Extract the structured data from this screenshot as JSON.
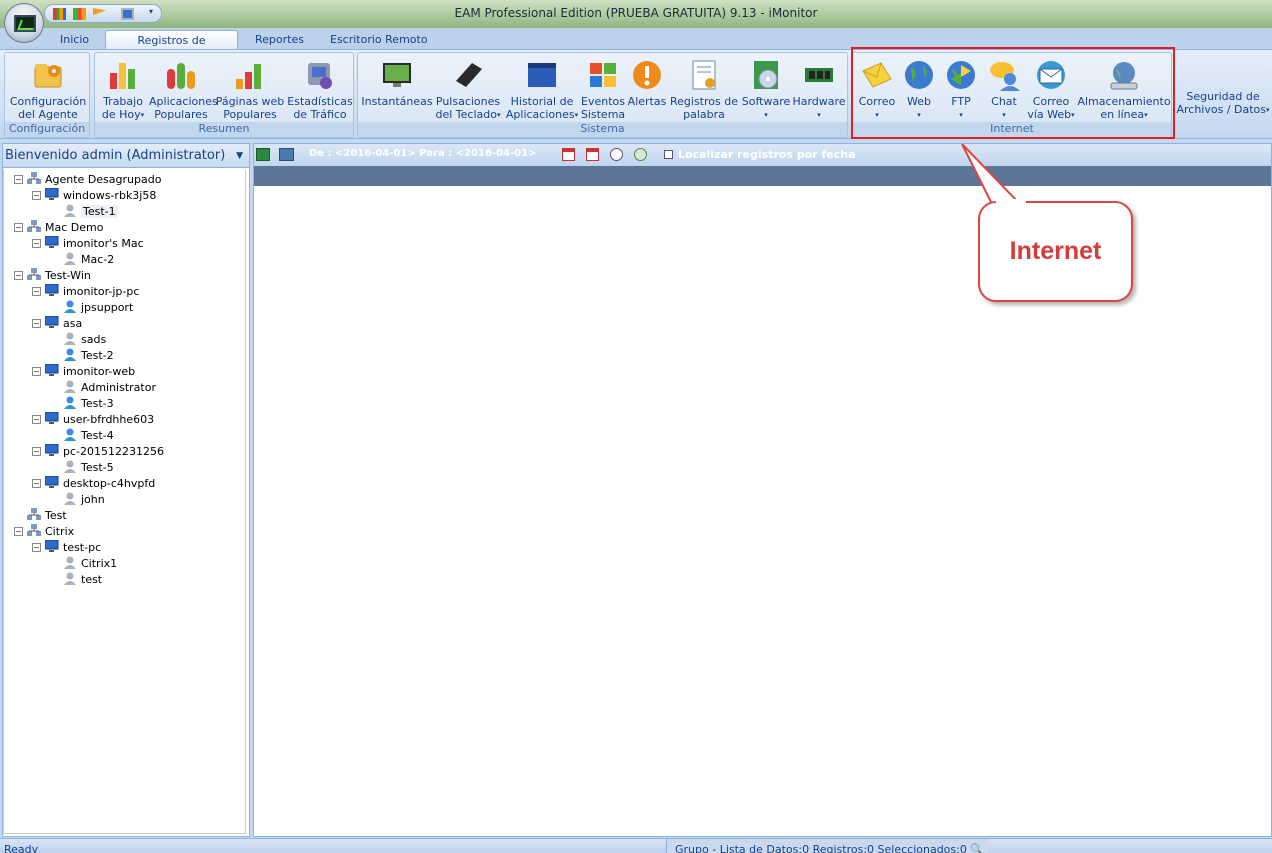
{
  "window": {
    "title": "EAM Professional Edition (PRUEBA GRATUITA) 9.13 - iMonitor"
  },
  "tabs": [
    "Inicio",
    "Registros de Equipos",
    "Reportes",
    "Escritorio Remoto"
  ],
  "groups": {
    "configuracion": "Configuración",
    "resumen": "Resumen",
    "sistema": "Sistema",
    "internet": "Internet"
  },
  "buttons": {
    "config_agente": "Configuración del Agente",
    "trabajo_hoy": "Trabajo de Hoy",
    "aplicaciones_populares": "Aplicaciones Populares",
    "paginas_web": "Páginas web Populares",
    "estadisticas": "Estadísticas de Tráfico",
    "instantaneas": "Instantáneas",
    "pulsaciones": "Pulsaciones del Teclado",
    "historial": "Historial de Aplicaciones",
    "eventos": "Eventos Sistema",
    "alertas": "Alertas",
    "registros_palabra": "Registros de palabra clave",
    "software": "Software",
    "hardware": "Hardware",
    "correo": "Correo",
    "web": "Web",
    "ftp": "FTP",
    "chat": "Chat",
    "correo_web": "Correo vía Web",
    "almacenamiento": "Almacenamiento en línea",
    "seguridad": "Seguridad de Archivos / Datos"
  },
  "left_panel": {
    "title": "Bienvenido admin (Administrator)"
  },
  "tree": [
    {
      "label": "Agente Desagrupado",
      "level": 0,
      "type": "group"
    },
    {
      "label": "windows-rbk3j58",
      "level": 1,
      "type": "pc"
    },
    {
      "label": "Test-1",
      "level": 2,
      "type": "user-gray"
    },
    {
      "label": "Mac Demo",
      "level": 0,
      "type": "group"
    },
    {
      "label": "imonitor's Mac",
      "level": 1,
      "type": "pc"
    },
    {
      "label": "Mac-2",
      "level": 2,
      "type": "user-gray"
    },
    {
      "label": "Test-Win",
      "level": 0,
      "type": "group"
    },
    {
      "label": "imonitor-jp-pc",
      "level": 1,
      "type": "pc"
    },
    {
      "label": "jpsupport",
      "level": 2,
      "type": "user-blue"
    },
    {
      "label": "asa",
      "level": 1,
      "type": "pc"
    },
    {
      "label": "sads",
      "level": 2,
      "type": "user-gray"
    },
    {
      "label": "Test-2",
      "level": 2,
      "type": "user-blue"
    },
    {
      "label": "imonitor-web",
      "level": 1,
      "type": "pc"
    },
    {
      "label": "Administrator",
      "level": 2,
      "type": "user-gray"
    },
    {
      "label": "Test-3",
      "level": 2,
      "type": "user-blue"
    },
    {
      "label": "user-bfrdhhe603",
      "level": 1,
      "type": "pc"
    },
    {
      "label": "Test-4",
      "level": 2,
      "type": "user-blue"
    },
    {
      "label": "pc-201512231256",
      "level": 1,
      "type": "pc"
    },
    {
      "label": "Test-5",
      "level": 2,
      "type": "user-gray"
    },
    {
      "label": "desktop-c4hvpfd",
      "level": 1,
      "type": "pc"
    },
    {
      "label": "john",
      "level": 2,
      "type": "user-gray"
    },
    {
      "label": "Test",
      "level": 0,
      "type": "group"
    },
    {
      "label": "Citrix",
      "level": 0,
      "type": "group"
    },
    {
      "label": "test-pc",
      "level": 1,
      "type": "pc"
    },
    {
      "label": "Citrix1",
      "level": 2,
      "type": "user-gray"
    },
    {
      "label": "test",
      "level": 2,
      "type": "user-gray"
    }
  ],
  "toolbar": {
    "date_range": "De : <2016-04-01> Para : <2016-04-01>",
    "locate_label": "Localizar registros por fecha"
  },
  "callout": {
    "text": "Internet"
  },
  "status": {
    "left": "Ready",
    "right": "Grupo - Lista de Datos:0  Registros:0  Seleccionados:0"
  }
}
